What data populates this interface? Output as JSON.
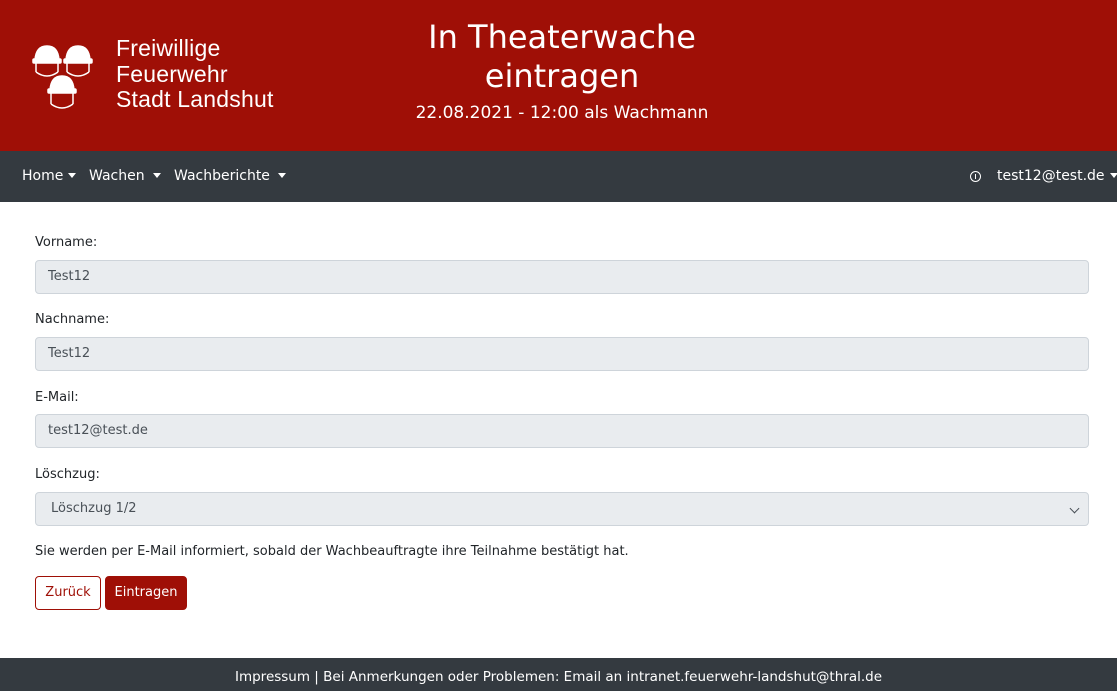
{
  "header": {
    "logo_lines": [
      "Freiwillige",
      "Feuerwehr",
      "Stadt Landshut"
    ],
    "title_line1": "In Theaterwache",
    "title_line2": "eintragen",
    "subtitle": "22.08.2021 - 12:00 als Wachmann"
  },
  "nav": {
    "home": "Home",
    "wachen": "Wachen",
    "wachberichte": "Wachberichte",
    "user": "test12@test.de"
  },
  "form": {
    "vorname_label": "Vorname:",
    "vorname_value": "Test12",
    "nachname_label": "Nachname:",
    "nachname_value": "Test12",
    "email_label": "E-Mail:",
    "email_value": "test12@test.de",
    "loeschzug_label": "Löschzug:",
    "loeschzug_value": "Löschzug 1/2",
    "notice": "Sie werden per E-Mail informiert, sobald der Wachbeauftragte ihre Teilnahme bestätigt hat.",
    "back_label": "Zurück",
    "submit_label": "Eintragen"
  },
  "footer": {
    "text": "Impressum | Bei Anmerkungen oder Problemen: Email an intranet.feuerwehr-landshut@thral.de"
  },
  "colors": {
    "brand_red": "#9f0f06",
    "navbar": "#343a40",
    "field_bg": "#e9ecef"
  }
}
